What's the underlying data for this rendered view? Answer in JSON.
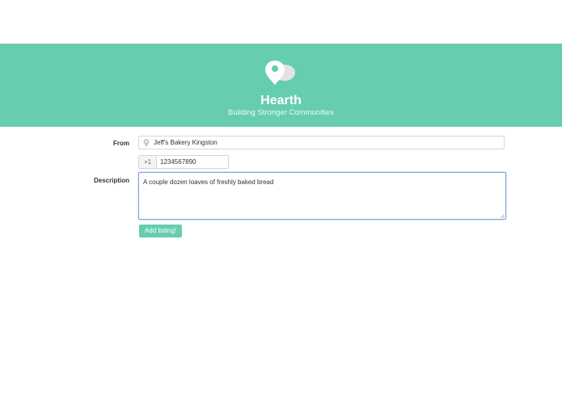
{
  "header": {
    "title": "Hearth",
    "subtitle": "Building Stronger Communities",
    "logo_icon": "map-pin-logo-icon",
    "background_color": "#66cdb1"
  },
  "form": {
    "from": {
      "label": "From",
      "value": "Jeff's Bakery Kingston",
      "icon": "map-pin-icon"
    },
    "phone": {
      "prefix": "+1",
      "value": "1234567890"
    },
    "description": {
      "label": "Description",
      "value": "A couple dozen loaves of freshly baked bread"
    },
    "submit_label": "Add listing!"
  },
  "colors": {
    "accent": "#66cdb1",
    "focus_border": "#7fa4d6"
  }
}
